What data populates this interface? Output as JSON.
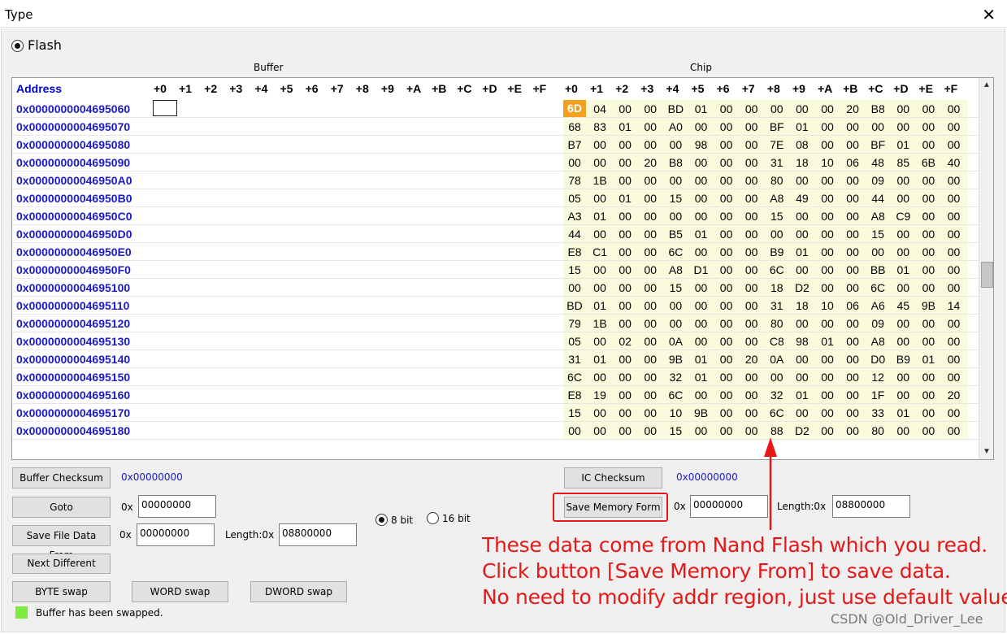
{
  "window": {
    "title": "Type",
    "close_glyph": "✕"
  },
  "flash_option": {
    "label": "Flash",
    "selected": true
  },
  "sections": {
    "buffer": "Buffer",
    "chip": "Chip"
  },
  "grid": {
    "address_header": "Address",
    "offsets": [
      "+0",
      "+1",
      "+2",
      "+3",
      "+4",
      "+5",
      "+6",
      "+7",
      "+8",
      "+9",
      "+A",
      "+B",
      "+C",
      "+D",
      "+E",
      "+F"
    ],
    "rows": [
      {
        "address": "0x0000000004695060",
        "chip": [
          "6D",
          "04",
          "00",
          "00",
          "BD",
          "01",
          "00",
          "00",
          "00",
          "00",
          "00",
          "20",
          "B8",
          "00",
          "00",
          "00"
        ]
      },
      {
        "address": "0x0000000004695070",
        "chip": [
          "68",
          "83",
          "01",
          "00",
          "A0",
          "00",
          "00",
          "00",
          "BF",
          "01",
          "00",
          "00",
          "00",
          "00",
          "00",
          "00"
        ]
      },
      {
        "address": "0x0000000004695080",
        "chip": [
          "B7",
          "00",
          "00",
          "00",
          "00",
          "98",
          "00",
          "00",
          "7E",
          "08",
          "00",
          "00",
          "BF",
          "01",
          "00",
          "00"
        ]
      },
      {
        "address": "0x0000000004695090",
        "chip": [
          "00",
          "00",
          "00",
          "20",
          "B8",
          "00",
          "00",
          "00",
          "31",
          "18",
          "10",
          "06",
          "48",
          "85",
          "6B",
          "40"
        ]
      },
      {
        "address": "0x00000000046950A0",
        "chip": [
          "78",
          "1B",
          "00",
          "00",
          "00",
          "00",
          "00",
          "00",
          "80",
          "00",
          "00",
          "00",
          "09",
          "00",
          "00",
          "00"
        ]
      },
      {
        "address": "0x00000000046950B0",
        "chip": [
          "05",
          "00",
          "01",
          "00",
          "15",
          "00",
          "00",
          "00",
          "A8",
          "49",
          "00",
          "00",
          "44",
          "00",
          "00",
          "00"
        ]
      },
      {
        "address": "0x00000000046950C0",
        "chip": [
          "A3",
          "01",
          "00",
          "00",
          "00",
          "00",
          "00",
          "00",
          "15",
          "00",
          "00",
          "00",
          "A8",
          "C9",
          "00",
          "00"
        ]
      },
      {
        "address": "0x00000000046950D0",
        "chip": [
          "44",
          "00",
          "00",
          "00",
          "B5",
          "01",
          "00",
          "00",
          "00",
          "00",
          "00",
          "00",
          "15",
          "00",
          "00",
          "00"
        ]
      },
      {
        "address": "0x00000000046950E0",
        "chip": [
          "E8",
          "C1",
          "00",
          "00",
          "6C",
          "00",
          "00",
          "00",
          "B9",
          "01",
          "00",
          "00",
          "00",
          "00",
          "00",
          "00"
        ]
      },
      {
        "address": "0x00000000046950F0",
        "chip": [
          "15",
          "00",
          "00",
          "00",
          "A8",
          "D1",
          "00",
          "00",
          "6C",
          "00",
          "00",
          "00",
          "BB",
          "01",
          "00",
          "00"
        ]
      },
      {
        "address": "0x0000000004695100",
        "chip": [
          "00",
          "00",
          "00",
          "00",
          "15",
          "00",
          "00",
          "00",
          "18",
          "D2",
          "00",
          "00",
          "6C",
          "00",
          "00",
          "00"
        ]
      },
      {
        "address": "0x0000000004695110",
        "chip": [
          "BD",
          "01",
          "00",
          "00",
          "00",
          "00",
          "00",
          "00",
          "31",
          "18",
          "10",
          "06",
          "A6",
          "45",
          "9B",
          "14"
        ]
      },
      {
        "address": "0x0000000004695120",
        "chip": [
          "79",
          "1B",
          "00",
          "00",
          "00",
          "00",
          "00",
          "00",
          "80",
          "00",
          "00",
          "00",
          "09",
          "00",
          "00",
          "00"
        ]
      },
      {
        "address": "0x0000000004695130",
        "chip": [
          "05",
          "00",
          "02",
          "00",
          "0A",
          "00",
          "00",
          "00",
          "C8",
          "98",
          "01",
          "00",
          "A8",
          "00",
          "00",
          "00"
        ]
      },
      {
        "address": "0x0000000004695140",
        "chip": [
          "31",
          "01",
          "00",
          "00",
          "9B",
          "01",
          "00",
          "20",
          "0A",
          "00",
          "00",
          "00",
          "D0",
          "B9",
          "01",
          "00"
        ]
      },
      {
        "address": "0x0000000004695150",
        "chip": [
          "6C",
          "00",
          "00",
          "00",
          "32",
          "01",
          "00",
          "00",
          "00",
          "00",
          "00",
          "00",
          "12",
          "00",
          "00",
          "00"
        ]
      },
      {
        "address": "0x0000000004695160",
        "chip": [
          "E8",
          "19",
          "00",
          "00",
          "6C",
          "00",
          "00",
          "00",
          "32",
          "01",
          "00",
          "00",
          "1F",
          "00",
          "00",
          "20"
        ]
      },
      {
        "address": "0x0000000004695170",
        "chip": [
          "15",
          "00",
          "00",
          "00",
          "10",
          "9B",
          "00",
          "00",
          "6C",
          "00",
          "00",
          "00",
          "33",
          "01",
          "00",
          "00"
        ]
      },
      {
        "address": "0x0000000004695180",
        "chip": [
          "00",
          "00",
          "00",
          "00",
          "15",
          "00",
          "00",
          "00",
          "88",
          "D2",
          "00",
          "00",
          "80",
          "00",
          "00",
          "00"
        ]
      }
    ]
  },
  "buffer_panel": {
    "checksum_label": "Buffer Checksum",
    "checksum_value": "0x00000000",
    "goto_label": "Goto",
    "goto_prefix": "0x",
    "goto_value": "00000000",
    "save_file_label": "Save File Data From",
    "save_prefix": "0x",
    "save_from": "00000000",
    "length_label": "Length:0x",
    "length_value": "08800000",
    "next_diff_label": "Next Different",
    "byte_swap": "BYTE swap",
    "word_swap": "WORD swap",
    "dword_swap": "DWORD swap",
    "swap_status": "Buffer has been swapped."
  },
  "bit_mode": {
    "opt8": "8 bit",
    "opt16": "16 bit",
    "selected": "8 bit"
  },
  "ic_panel": {
    "checksum_label": "IC Checksum",
    "checksum_value": "0x00000000",
    "save_mem_label": "Save Memory Form",
    "save_prefix": "0x",
    "save_from": "00000000",
    "length_label": "Length:0x",
    "length_value": "08800000"
  },
  "annotation": {
    "line1": "These data come from Nand Flash which you read.",
    "line2": "Click button [Save Memory From] to save data.",
    "line3": "No need to modify addr region, just use default value",
    "color": "#e81818"
  },
  "watermark": "CSDN @Old_Driver_Lee"
}
